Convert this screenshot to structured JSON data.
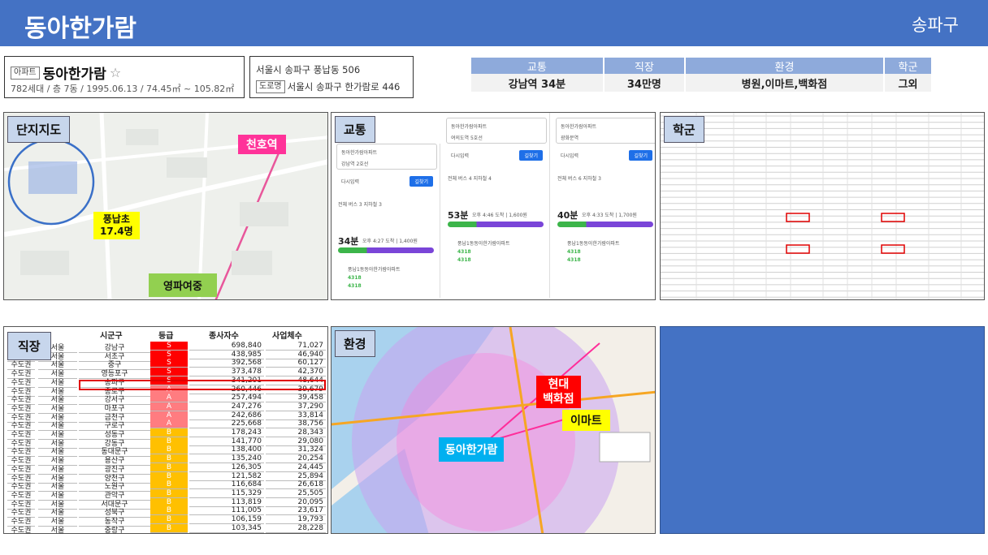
{
  "header": {
    "title": "동아한가람",
    "region": "송파구"
  },
  "complex": {
    "type_tag": "아파트",
    "name": "동아한가람",
    "star": "☆",
    "details": "782세대 / 층 7동 / 1995.06.13 / 74.45㎡ ~ 105.82㎡"
  },
  "address": {
    "jibun": "서울시 송파구 풍납동 506",
    "road_tag": "도로명",
    "road": "서울시 송파구 한가람로 446"
  },
  "summary": {
    "headers": [
      "교통",
      "직장",
      "환경",
      "학군"
    ],
    "values": [
      "강남역 34분",
      "34만명",
      "병원,이마트,백화점",
      "그외"
    ]
  },
  "panels": {
    "map": {
      "label": "단지지도",
      "station": "천호역",
      "school_line1": "풍납초",
      "school_line2": "17.4명",
      "middle_school": "영파여중"
    },
    "transport": {
      "label": "교통",
      "cards": [
        {
          "from": "동아한가람아파트",
          "to": "강남역 2호선",
          "tabs": "전체 버스 3 지하철 3",
          "time": "34분",
          "detail": "오후 4:27 도착 | 1,400원",
          "route": "풍납1동동아한가람아파트",
          "b1": "4318",
          "b2": "4318"
        },
        {
          "from": "동아한가람아파트",
          "to": "여의도역 5호선",
          "tabs": "전체 버스 4 지하철 4",
          "time": "53분",
          "detail": "오후 4:46 도착 | 1,600원",
          "route": "풍납1동동아한가람아파트",
          "b1": "4318",
          "b2": "4318"
        },
        {
          "from": "동아한가람아파트",
          "to": "광화문역",
          "tabs": "전체 버스 6 지하철 3",
          "time": "40분",
          "detail": "오후 4:33 도착 | 1,700원",
          "route": "풍납1동동아한가람아파트",
          "b1": "4318",
          "b2": "4318"
        }
      ],
      "search_btn": "길찾기",
      "add_stop": "다시입력"
    },
    "school": {
      "label": "학군"
    },
    "work": {
      "label": "직장",
      "headers": [
        "시군구",
        "등급",
        "종사자수",
        "사업체수"
      ],
      "rows": [
        [
          "수도권",
          "서울",
          "강남구",
          "S",
          "698,840",
          "71,027"
        ],
        [
          "수도권",
          "서울",
          "서초구",
          "S",
          "438,985",
          "46,940"
        ],
        [
          "수도권",
          "서울",
          "중구",
          "S",
          "392,568",
          "60,127"
        ],
        [
          "수도권",
          "서울",
          "영등포구",
          "S",
          "373,478",
          "42,370"
        ],
        [
          "수도권",
          "서울",
          "송파구",
          "S",
          "341,201",
          "48,644"
        ],
        [
          "수도권",
          "서울",
          "종로구",
          "A",
          "260,446",
          "39,679"
        ],
        [
          "수도권",
          "서울",
          "강서구",
          "A",
          "257,494",
          "39,458"
        ],
        [
          "수도권",
          "서울",
          "마포구",
          "A",
          "247,276",
          "37,290"
        ],
        [
          "수도권",
          "서울",
          "금천구",
          "A",
          "242,686",
          "33,814"
        ],
        [
          "수도권",
          "서울",
          "구로구",
          "A",
          "225,668",
          "38,756"
        ],
        [
          "수도권",
          "서울",
          "성동구",
          "B",
          "178,243",
          "28,343"
        ],
        [
          "수도권",
          "서울",
          "강동구",
          "B",
          "141,770",
          "29,080"
        ],
        [
          "수도권",
          "서울",
          "동대문구",
          "B",
          "138,400",
          "31,324"
        ],
        [
          "수도권",
          "서울",
          "용산구",
          "B",
          "135,240",
          "20,254"
        ],
        [
          "수도권",
          "서울",
          "광진구",
          "B",
          "126,305",
          "24,445"
        ],
        [
          "수도권",
          "서울",
          "양천구",
          "B",
          "121,582",
          "25,894"
        ],
        [
          "수도권",
          "서울",
          "노원구",
          "B",
          "116,684",
          "26,618"
        ],
        [
          "수도권",
          "서울",
          "관악구",
          "B",
          "115,329",
          "25,505"
        ],
        [
          "수도권",
          "서울",
          "서대문구",
          "B",
          "113,819",
          "20,095"
        ],
        [
          "수도권",
          "서울",
          "성북구",
          "B",
          "111,005",
          "23,617"
        ],
        [
          "수도권",
          "서울",
          "동작구",
          "B",
          "106,159",
          "19,793"
        ],
        [
          "수도권",
          "서울",
          "중랑구",
          "B",
          "103,345",
          "28,228"
        ]
      ]
    },
    "env": {
      "label": "환경",
      "dept": "현대\n백화점",
      "mart": "이마트",
      "complex": "동아한가람"
    }
  },
  "colors": {
    "header": "#4472c4",
    "grade_s": "#ff0000",
    "grade_a": "#ff7c80",
    "grade_b": "#ffc000",
    "blank_panel": "#4472c4"
  }
}
